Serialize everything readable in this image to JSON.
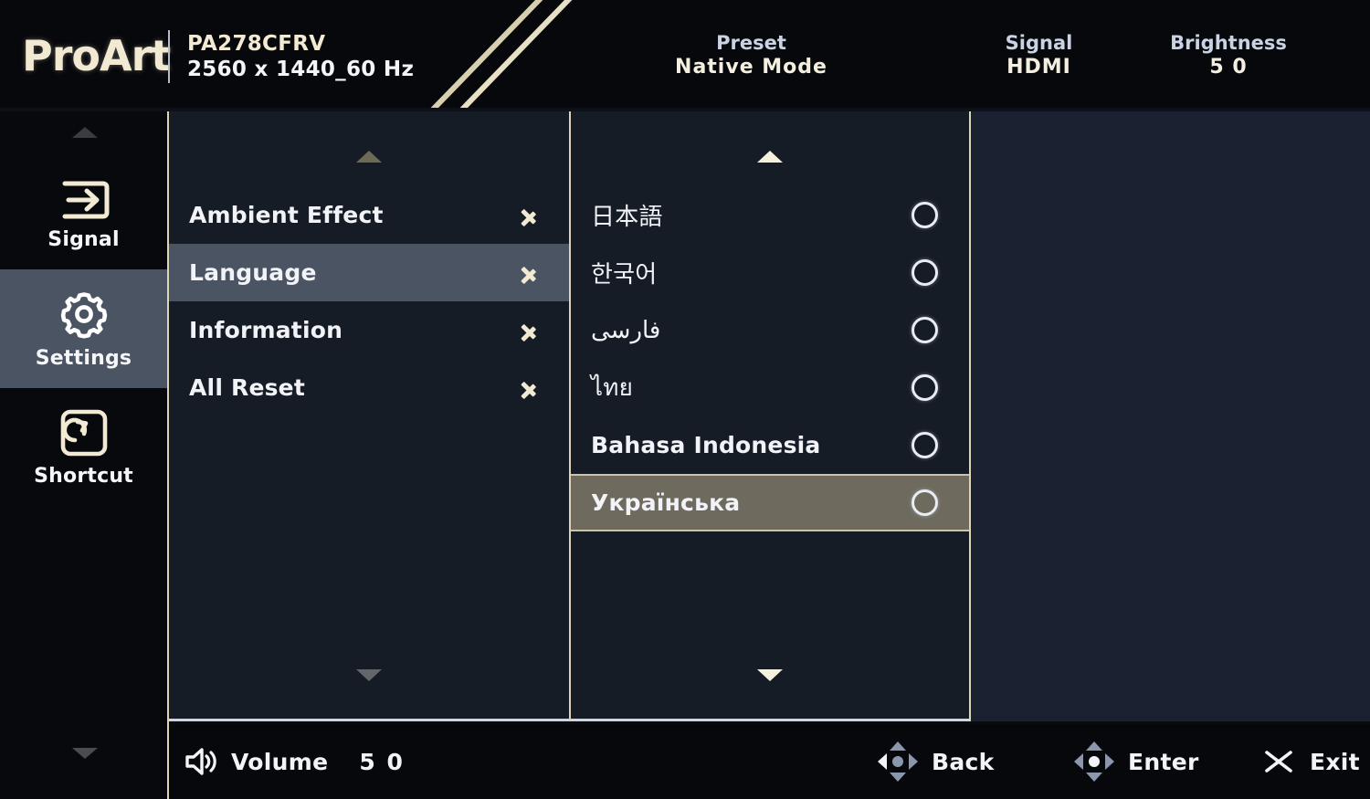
{
  "header": {
    "brand": "ProArt",
    "model": "PA278CFRV",
    "resolution": "2560 x 1440_60 Hz",
    "stats": [
      {
        "key": "Preset",
        "value": "Native Mode",
        "name": "preset"
      },
      {
        "key": "Signal",
        "value": "HDMI",
        "name": "signal"
      },
      {
        "key": "Brightness",
        "value": "5 0",
        "name": "brightness"
      }
    ]
  },
  "sidebar": {
    "scroll_up_icon": "triangle-up-icon",
    "scroll_down_icon": "triangle-down-icon",
    "items": [
      {
        "label": "Signal",
        "icon": "signal-input-icon",
        "active": false
      },
      {
        "label": "Settings",
        "icon": "gear-icon",
        "active": true
      },
      {
        "label": "Shortcut",
        "icon": "shortcut-redo-icon",
        "active": false
      }
    ]
  },
  "menu": {
    "scroll_up_icon": "triangle-up-icon",
    "scroll_down_icon": "triangle-down-icon",
    "items": [
      {
        "label": "Ambient Effect",
        "selected": false,
        "chevron": "chevron-right-icon"
      },
      {
        "label": "Language",
        "selected": true,
        "chevron": "chevron-right-icon"
      },
      {
        "label": "Information",
        "selected": false,
        "chevron": "chevron-right-icon"
      },
      {
        "label": "All Reset",
        "selected": false,
        "chevron": "chevron-right-icon"
      }
    ]
  },
  "language_list": {
    "scroll_up_icon": "triangle-up-icon",
    "scroll_down_icon": "triangle-down-icon",
    "items": [
      {
        "label": "日本語",
        "selected": false,
        "cjk": true,
        "checked": false
      },
      {
        "label": "한국어",
        "selected": false,
        "cjk": true,
        "checked": false
      },
      {
        "label": "فارسی",
        "selected": false,
        "cjk": true,
        "checked": false
      },
      {
        "label": "ไทย",
        "selected": false,
        "cjk": true,
        "checked": false
      },
      {
        "label": "Bahasa Indonesia",
        "selected": false,
        "cjk": false,
        "checked": false
      },
      {
        "label": "Українська",
        "selected": true,
        "cjk": false,
        "checked": false
      }
    ]
  },
  "footer": {
    "volume_label": "Volume",
    "volume_value": "5 0",
    "volume_icon": "speaker-icon",
    "back_label": "Back",
    "back_icon": "nav-pad-left-icon",
    "enter_label": "Enter",
    "enter_icon": "nav-pad-center-icon",
    "exit_label": "Exit",
    "exit_icon": "close-x-icon"
  },
  "colors": {
    "accent_cream": "#ded4b8",
    "selection_slate": "#4b5462",
    "selection_taupe": "#6e6a5e",
    "panel_bg": "#161c26",
    "header_bg": "#07080c",
    "text_primary": "#f1f3f7",
    "brand_gold": "#f2e9d2"
  }
}
